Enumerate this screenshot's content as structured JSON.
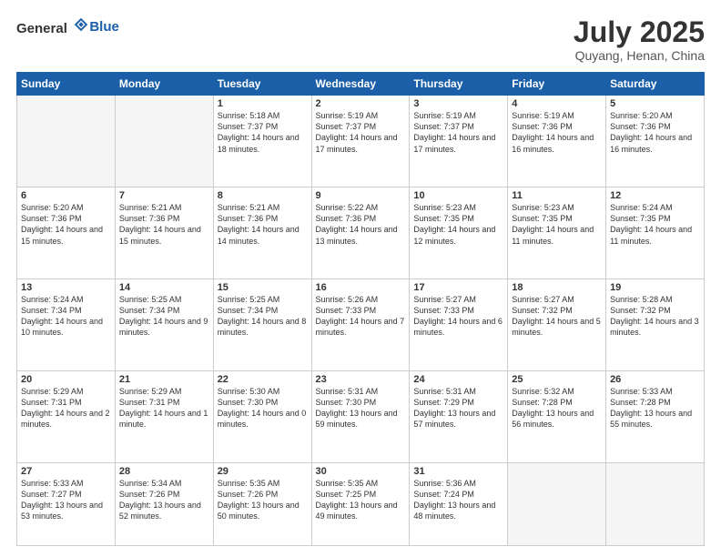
{
  "header": {
    "logo_general": "General",
    "logo_blue": "Blue",
    "month_title": "July 2025",
    "location": "Quyang, Henan, China"
  },
  "days_of_week": [
    "Sunday",
    "Monday",
    "Tuesday",
    "Wednesday",
    "Thursday",
    "Friday",
    "Saturday"
  ],
  "weeks": [
    [
      {
        "day": "",
        "info": ""
      },
      {
        "day": "",
        "info": ""
      },
      {
        "day": "1",
        "info": "Sunrise: 5:18 AM\nSunset: 7:37 PM\nDaylight: 14 hours\nand 18 minutes."
      },
      {
        "day": "2",
        "info": "Sunrise: 5:19 AM\nSunset: 7:37 PM\nDaylight: 14 hours\nand 17 minutes."
      },
      {
        "day": "3",
        "info": "Sunrise: 5:19 AM\nSunset: 7:37 PM\nDaylight: 14 hours\nand 17 minutes."
      },
      {
        "day": "4",
        "info": "Sunrise: 5:19 AM\nSunset: 7:36 PM\nDaylight: 14 hours\nand 16 minutes."
      },
      {
        "day": "5",
        "info": "Sunrise: 5:20 AM\nSunset: 7:36 PM\nDaylight: 14 hours\nand 16 minutes."
      }
    ],
    [
      {
        "day": "6",
        "info": "Sunrise: 5:20 AM\nSunset: 7:36 PM\nDaylight: 14 hours\nand 15 minutes."
      },
      {
        "day": "7",
        "info": "Sunrise: 5:21 AM\nSunset: 7:36 PM\nDaylight: 14 hours\nand 15 minutes."
      },
      {
        "day": "8",
        "info": "Sunrise: 5:21 AM\nSunset: 7:36 PM\nDaylight: 14 hours\nand 14 minutes."
      },
      {
        "day": "9",
        "info": "Sunrise: 5:22 AM\nSunset: 7:36 PM\nDaylight: 14 hours\nand 13 minutes."
      },
      {
        "day": "10",
        "info": "Sunrise: 5:23 AM\nSunset: 7:35 PM\nDaylight: 14 hours\nand 12 minutes."
      },
      {
        "day": "11",
        "info": "Sunrise: 5:23 AM\nSunset: 7:35 PM\nDaylight: 14 hours\nand 11 minutes."
      },
      {
        "day": "12",
        "info": "Sunrise: 5:24 AM\nSunset: 7:35 PM\nDaylight: 14 hours\nand 11 minutes."
      }
    ],
    [
      {
        "day": "13",
        "info": "Sunrise: 5:24 AM\nSunset: 7:34 PM\nDaylight: 14 hours\nand 10 minutes."
      },
      {
        "day": "14",
        "info": "Sunrise: 5:25 AM\nSunset: 7:34 PM\nDaylight: 14 hours\nand 9 minutes."
      },
      {
        "day": "15",
        "info": "Sunrise: 5:25 AM\nSunset: 7:34 PM\nDaylight: 14 hours\nand 8 minutes."
      },
      {
        "day": "16",
        "info": "Sunrise: 5:26 AM\nSunset: 7:33 PM\nDaylight: 14 hours\nand 7 minutes."
      },
      {
        "day": "17",
        "info": "Sunrise: 5:27 AM\nSunset: 7:33 PM\nDaylight: 14 hours\nand 6 minutes."
      },
      {
        "day": "18",
        "info": "Sunrise: 5:27 AM\nSunset: 7:32 PM\nDaylight: 14 hours\nand 5 minutes."
      },
      {
        "day": "19",
        "info": "Sunrise: 5:28 AM\nSunset: 7:32 PM\nDaylight: 14 hours\nand 3 minutes."
      }
    ],
    [
      {
        "day": "20",
        "info": "Sunrise: 5:29 AM\nSunset: 7:31 PM\nDaylight: 14 hours\nand 2 minutes."
      },
      {
        "day": "21",
        "info": "Sunrise: 5:29 AM\nSunset: 7:31 PM\nDaylight: 14 hours\nand 1 minute."
      },
      {
        "day": "22",
        "info": "Sunrise: 5:30 AM\nSunset: 7:30 PM\nDaylight: 14 hours\nand 0 minutes."
      },
      {
        "day": "23",
        "info": "Sunrise: 5:31 AM\nSunset: 7:30 PM\nDaylight: 13 hours\nand 59 minutes."
      },
      {
        "day": "24",
        "info": "Sunrise: 5:31 AM\nSunset: 7:29 PM\nDaylight: 13 hours\nand 57 minutes."
      },
      {
        "day": "25",
        "info": "Sunrise: 5:32 AM\nSunset: 7:28 PM\nDaylight: 13 hours\nand 56 minutes."
      },
      {
        "day": "26",
        "info": "Sunrise: 5:33 AM\nSunset: 7:28 PM\nDaylight: 13 hours\nand 55 minutes."
      }
    ],
    [
      {
        "day": "27",
        "info": "Sunrise: 5:33 AM\nSunset: 7:27 PM\nDaylight: 13 hours\nand 53 minutes."
      },
      {
        "day": "28",
        "info": "Sunrise: 5:34 AM\nSunset: 7:26 PM\nDaylight: 13 hours\nand 52 minutes."
      },
      {
        "day": "29",
        "info": "Sunrise: 5:35 AM\nSunset: 7:26 PM\nDaylight: 13 hours\nand 50 minutes."
      },
      {
        "day": "30",
        "info": "Sunrise: 5:35 AM\nSunset: 7:25 PM\nDaylight: 13 hours\nand 49 minutes."
      },
      {
        "day": "31",
        "info": "Sunrise: 5:36 AM\nSunset: 7:24 PM\nDaylight: 13 hours\nand 48 minutes."
      },
      {
        "day": "",
        "info": ""
      },
      {
        "day": "",
        "info": ""
      }
    ]
  ]
}
